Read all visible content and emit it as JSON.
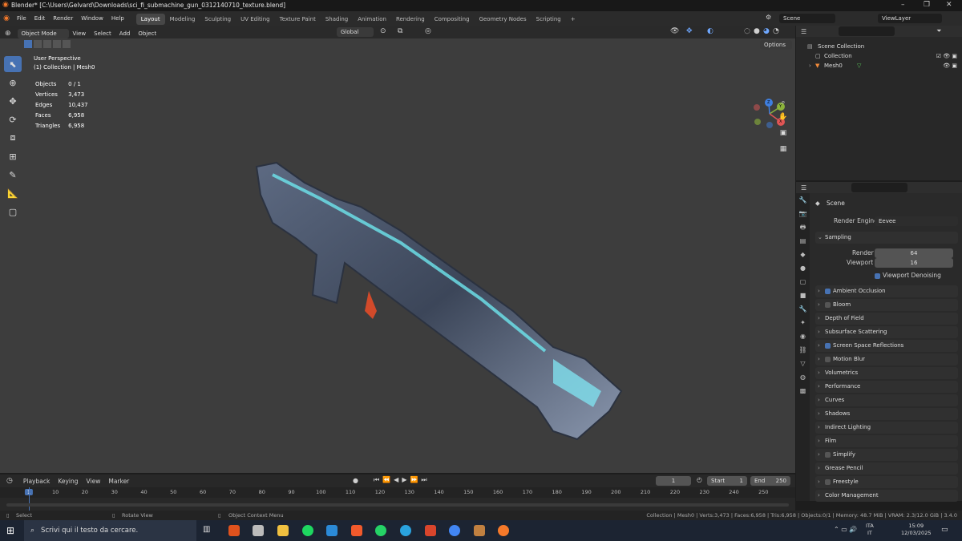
{
  "titlebar": {
    "title": "Blender* [C:\\Users\\Gelvard\\Downloads\\sci_fi_submachine_gun_0312140710_texture.blend]"
  },
  "menu": {
    "items": [
      "File",
      "Edit",
      "Render",
      "Window",
      "Help"
    ]
  },
  "workspaces": [
    "Layout",
    "Modeling",
    "Sculpting",
    "UV Editing",
    "Texture Paint",
    "Shading",
    "Animation",
    "Rendering",
    "Compositing",
    "Geometry Nodes",
    "Scripting",
    "+"
  ],
  "scene": {
    "scene_name": "Scene",
    "view_layer": "ViewLayer"
  },
  "viewport_header": {
    "mode": "Object Mode",
    "menus": [
      "View",
      "Select",
      "Add",
      "Object"
    ],
    "transform": "Global",
    "options": "Options"
  },
  "overlay": {
    "perspective": "User Perspective",
    "collection": "(1) Collection | Mesh0"
  },
  "stats": [
    {
      "label": "Objects",
      "value": "0 / 1"
    },
    {
      "label": "Vertices",
      "value": "3,473"
    },
    {
      "label": "Edges",
      "value": "10,437"
    },
    {
      "label": "Faces",
      "value": "6,958"
    },
    {
      "label": "Triangles",
      "value": "6,958"
    }
  ],
  "gizmo": {
    "x": "X",
    "y": "Y",
    "z": "Z"
  },
  "outliner": {
    "root": "Scene Collection",
    "collection": "Collection",
    "object": "Mesh0"
  },
  "properties": {
    "scene": "Scene",
    "render_engine_label": "Render Engine",
    "render_engine": "Eevee",
    "sampling": "Sampling",
    "render_label": "Render",
    "render_value": "64",
    "viewport_label": "Viewport",
    "viewport_value": "16",
    "viewport_denoising": "Viewport Denoising",
    "panels": [
      {
        "label": "Ambient Occlusion",
        "checkbox": true,
        "checked": true
      },
      {
        "label": "Bloom",
        "checkbox": true,
        "checked": false
      },
      {
        "label": "Depth of Field",
        "checkbox": false
      },
      {
        "label": "Subsurface Scattering",
        "checkbox": false
      },
      {
        "label": "Screen Space Reflections",
        "checkbox": true,
        "checked": true
      },
      {
        "label": "Motion Blur",
        "checkbox": true,
        "checked": false
      },
      {
        "label": "Volumetrics",
        "checkbox": false
      },
      {
        "label": "Performance",
        "checkbox": false
      },
      {
        "label": "Curves",
        "checkbox": false
      },
      {
        "label": "Shadows",
        "checkbox": false
      },
      {
        "label": "Indirect Lighting",
        "checkbox": false
      },
      {
        "label": "Film",
        "checkbox": false
      },
      {
        "label": "Simplify",
        "checkbox": true,
        "checked": false
      },
      {
        "label": "Grease Pencil",
        "checkbox": false
      },
      {
        "label": "Freestyle",
        "checkbox": true,
        "checked": false
      },
      {
        "label": "Color Management",
        "checkbox": false
      }
    ]
  },
  "timeline": {
    "menus": [
      "Playback",
      "Keying",
      "View",
      "Marker"
    ],
    "current_frame": "1",
    "start_label": "Start",
    "start": "1",
    "end_label": "End",
    "end": "250",
    "ticks": [
      "1",
      "10",
      "20",
      "30",
      "40",
      "50",
      "60",
      "70",
      "80",
      "90",
      "100",
      "110",
      "120",
      "130",
      "140",
      "150",
      "160",
      "170",
      "180",
      "190",
      "200",
      "210",
      "220",
      "230",
      "240",
      "250"
    ]
  },
  "statusbar": {
    "select": "Select",
    "rotate": "Rotate View",
    "context": "Object Context Menu",
    "info": "Collection | Mesh0 | Verts:3,473 | Faces:6,958 | Tris:6,958 | Objects:0/1 | Memory: 48.7 MiB | VRAM: 2.3/12.0 GiB | 3.4.0"
  },
  "taskbar": {
    "search": "Scrivi qui il testo da cercare.",
    "lang1": "ITA",
    "lang2": "IT",
    "time": "15:09",
    "date": "12/03/2025"
  }
}
